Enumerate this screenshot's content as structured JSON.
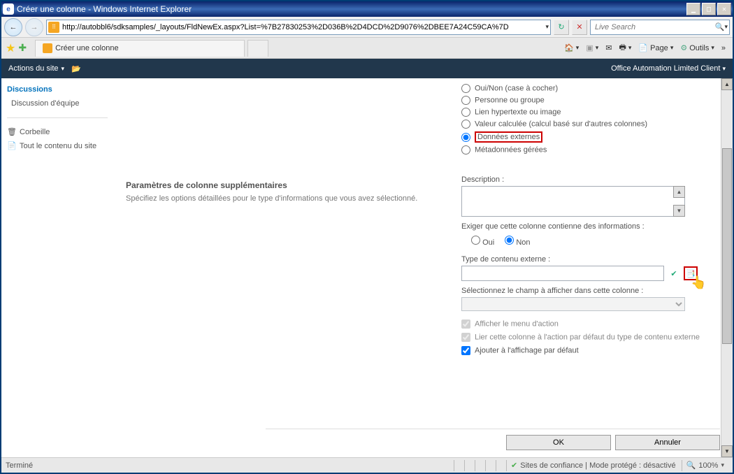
{
  "window": {
    "title": "Créer une colonne - Windows Internet Explorer"
  },
  "addressbar": {
    "url": "http://autobbl6/sdksamples/_layouts/FldNewEx.aspx?List=%7B27830253%2D036B%2D4DCD%2D9076%2DBEE7A24C59CA%7D",
    "search_placeholder": "Live Search"
  },
  "tab": {
    "title": "Créer une colonne"
  },
  "toolbar": {
    "page": "Page",
    "outils": "Outils"
  },
  "ribbon": {
    "site_actions": "Actions du site",
    "client": "Office Automation Limited Client"
  },
  "leftnav": {
    "discussions_hdr": "Discussions",
    "discussion_equipe": "Discussion d'équipe",
    "corbeille": "Corbeille",
    "tout_contenu": "Tout le contenu du site"
  },
  "column_types": {
    "oui_non": "Oui/Non (case à cocher)",
    "personne": "Personne ou groupe",
    "lien": "Lien hypertexte ou image",
    "calc": "Valeur calculée (calcul basé sur d'autres colonnes)",
    "externes": "Données externes",
    "meta": "Métadonnées gérées"
  },
  "section": {
    "hdr": "Paramètres de colonne supplémentaires",
    "desc": "Spécifiez les options détaillées pour le type d'informations que vous avez sélectionné."
  },
  "fields": {
    "description": "Description :",
    "require": "Exiger que cette colonne contienne des informations :",
    "oui": "Oui",
    "non": "Non",
    "ect": "Type de contenu externe :",
    "select_field": "Sélectionnez le champ à afficher dans cette colonne :",
    "menu_action": "Afficher le menu d'action",
    "lier": "Lier cette colonne à l'action par défaut du type de contenu externe",
    "ajouter": "Ajouter à l'affichage par défaut"
  },
  "buttons": {
    "ok": "OK",
    "annuler": "Annuler"
  },
  "status": {
    "termine": "Terminé",
    "zone": "Sites de confiance | Mode protégé : désactivé",
    "zoom": "100%"
  }
}
